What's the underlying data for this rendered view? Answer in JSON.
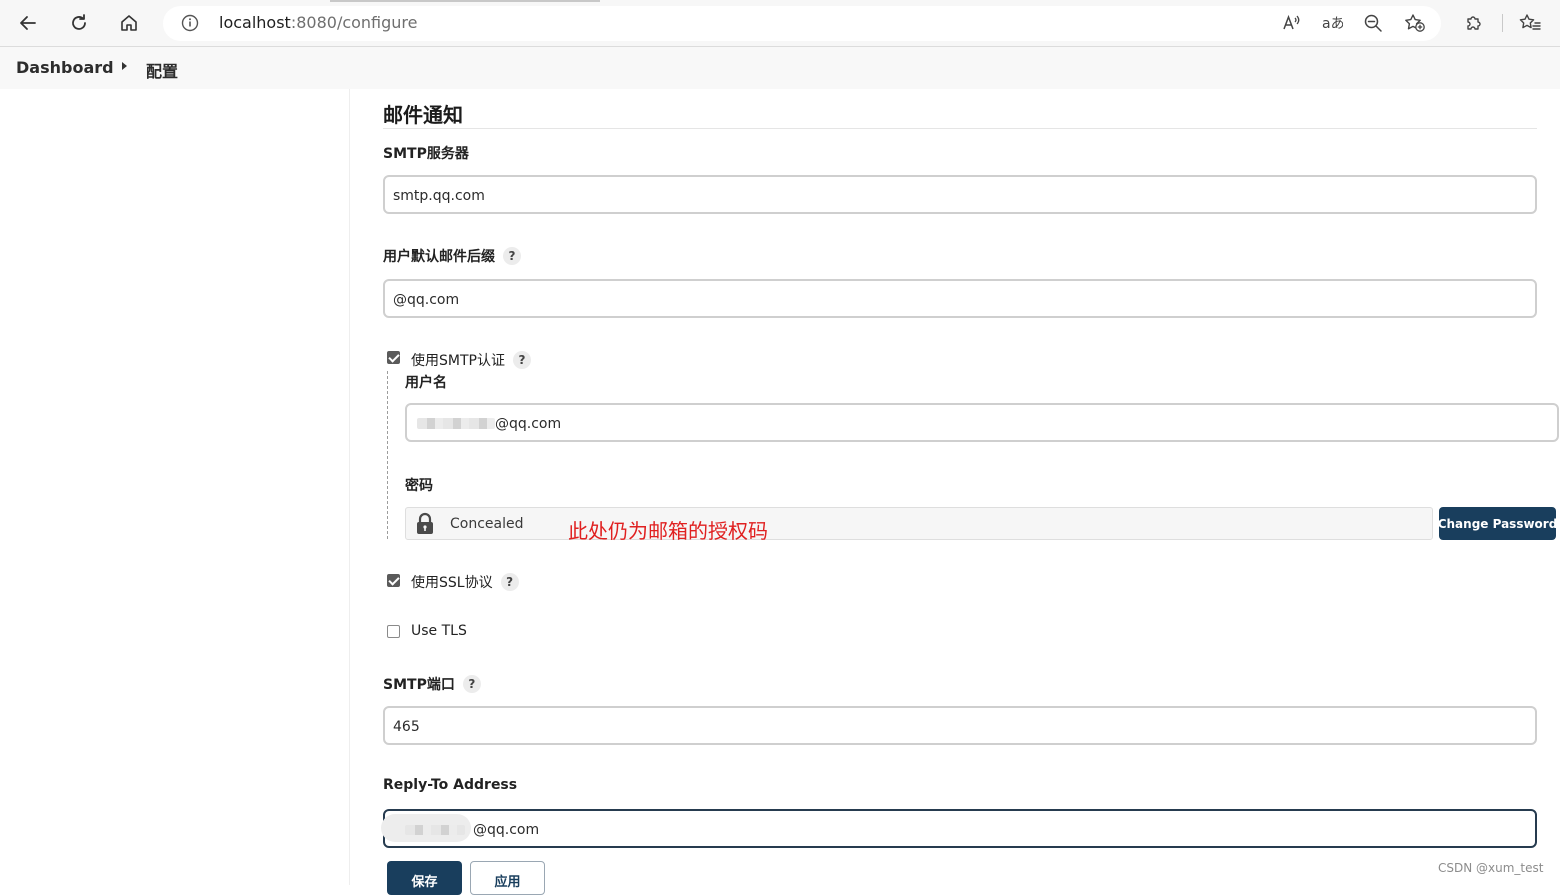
{
  "browser": {
    "address": {
      "host": "localhost",
      "path": ":8080/configure"
    }
  },
  "breadcrumb": {
    "items": [
      "Dashboard",
      "配置"
    ]
  },
  "section": {
    "title": "邮件通知"
  },
  "smtp_server": {
    "label": "SMTP服务器",
    "value": "smtp.qq.com"
  },
  "default_suffix": {
    "label": "用户默认邮件后缀",
    "value": "@qq.com",
    "help": "?"
  },
  "smtp_auth": {
    "label": "使用SMTP认证",
    "checked": true,
    "help": "?",
    "username": {
      "label": "用户名",
      "value_suffix": "@qq.com"
    },
    "password": {
      "label": "密码",
      "value": "Concealed",
      "change_button": "Change Password"
    }
  },
  "annotation": {
    "text": "此处仍为邮箱的授权码",
    "color": "#e02020"
  },
  "use_ssl": {
    "label": "使用SSL协议",
    "checked": true,
    "help": "?"
  },
  "use_tls": {
    "label": "Use TLS",
    "checked": false
  },
  "smtp_port": {
    "label": "SMTP端口",
    "value": "465",
    "help": "?"
  },
  "reply_to": {
    "label": "Reply-To Address",
    "value_suffix": "@qq.com"
  },
  "actions": {
    "save": "保存",
    "apply": "应用"
  },
  "watermark": "CSDN @xum_test",
  "colors": {
    "primary_button": "#193e5d",
    "annotation": "#e02020"
  }
}
